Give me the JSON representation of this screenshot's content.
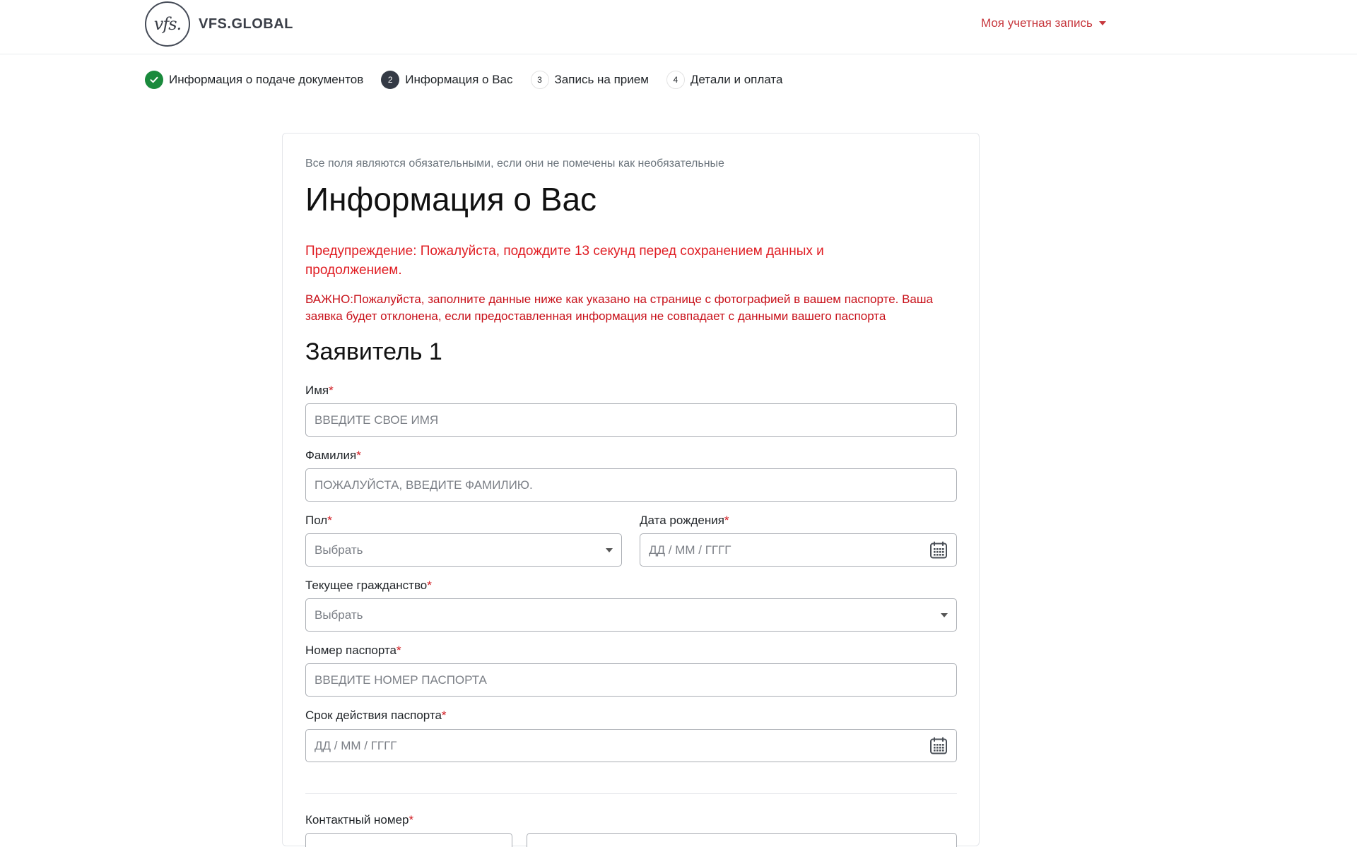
{
  "header": {
    "logo_mark": "vfs.",
    "logo_text": "VFS.GLOBAL",
    "account_menu": "Моя учетная запись"
  },
  "stepper": {
    "steps": [
      {
        "badge": "",
        "label": "Информация о подаче документов",
        "state": "done"
      },
      {
        "badge": "2",
        "label": "Информация о Вас",
        "state": "current"
      },
      {
        "badge": "3",
        "label": "Запись на прием",
        "state": "future"
      },
      {
        "badge": "4",
        "label": "Детали и оплата",
        "state": "future"
      }
    ]
  },
  "form": {
    "required_note": "Все поля являются обязательными, если они не помечены как необязательные",
    "title": "Информация о Вас",
    "warning": "Предупреждение: Пожалуйста, подождите 13 секунд перед сохранением данных и продолжением.",
    "important": "ВАЖНО:Пожалуйста, заполните данные ниже как указано на странице с фотографией в вашем паспорте. Ваша заявка будет отклонена, если предоставленная информация не совпадает с данными вашего паспорта",
    "applicant_title": "Заявитель 1",
    "required_mark": "*",
    "fields": {
      "first_name": {
        "label": "Имя",
        "placeholder": "ВВЕДИТЕ СВОЕ ИМЯ"
      },
      "last_name": {
        "label": "Фамилия",
        "placeholder": "ПОЖАЛУЙСТА, ВВЕДИТЕ ФАМИЛИЮ."
      },
      "gender": {
        "label": "Пол",
        "value": "Выбрать"
      },
      "dob": {
        "label": "Дата рождения",
        "placeholder": "ДД / ММ / ГГГГ"
      },
      "citizenship": {
        "label": "Текущее гражданство",
        "value": "Выбрать"
      },
      "passport_number": {
        "label": "Номер паспорта",
        "placeholder": "ВВЕДИТЕ НОМЕР ПАСПОРТА"
      },
      "passport_expiry": {
        "label": "Срок действия паспорта",
        "placeholder": "ДД / ММ / ГГГГ"
      },
      "contact_number": {
        "label": "Контактный номер"
      }
    }
  },
  "colors": {
    "accent_red": "#c7373d",
    "warning_red": "#e01d23",
    "step_done": "#1a8a3c",
    "step_current": "#343a45"
  }
}
